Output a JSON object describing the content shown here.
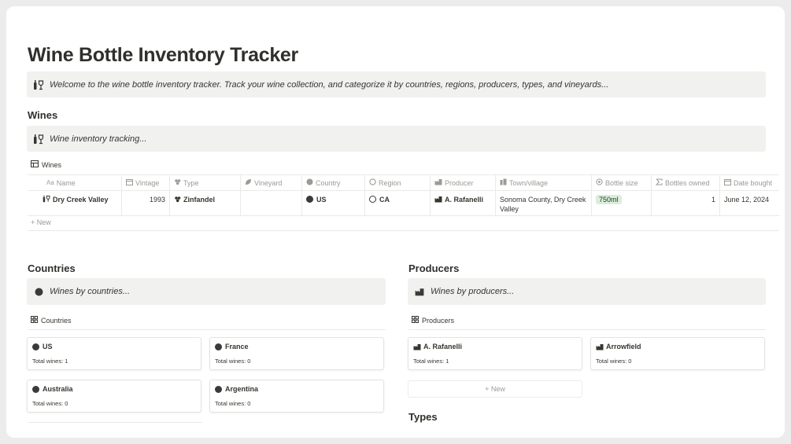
{
  "page": {
    "title": "Wine Bottle Inventory Tracker"
  },
  "intro": {
    "icon": "wine-glass-bottle-icon",
    "text": "Welcome to the wine bottle inventory tracker. Track your wine collection, and categorize it by countries, regions, producers, types, and vineyards..."
  },
  "wines": {
    "heading": "Wines",
    "callout_text": "Wine inventory tracking...",
    "view_label": "Wines",
    "columns": [
      {
        "label": "Name",
        "icon": "Aa"
      },
      {
        "label": "Vintage",
        "icon": "calendar-icon"
      },
      {
        "label": "Type",
        "icon": "grapes-icon"
      },
      {
        "label": "Vineyard",
        "icon": "leaf-icon"
      },
      {
        "label": "Country",
        "icon": "circle-icon"
      },
      {
        "label": "Region",
        "icon": "ring-icon"
      },
      {
        "label": "Producer",
        "icon": "factory-icon"
      },
      {
        "label": "Town/village",
        "icon": "building-icon"
      },
      {
        "label": "Bottle size",
        "icon": "target-icon"
      },
      {
        "label": "Bottles owned",
        "icon": "sigma-icon"
      },
      {
        "label": "Date bought",
        "icon": "calendar-icon"
      }
    ],
    "rows": [
      {
        "name": "Dry Creek Valley",
        "vintage": "1993",
        "type": "Zinfandel",
        "vineyard": "",
        "country": "US",
        "region": "CA",
        "producer": "A. Rafanelli",
        "town": "Sonoma County, Dry Creek Valley",
        "bottle_size": "750ml",
        "bottles_owned": "1",
        "date_bought": "June 12, 2024"
      }
    ],
    "new_label": "New"
  },
  "countries": {
    "heading": "Countries",
    "callout_text": "Wines by countries...",
    "view_label": "Countries",
    "cards": [
      {
        "name": "US",
        "total": "Total wines: 1"
      },
      {
        "name": "France",
        "total": "Total wines: 0"
      },
      {
        "name": "Australia",
        "total": "Total wines: 0"
      },
      {
        "name": "Argentina",
        "total": "Total wines: 0"
      }
    ]
  },
  "producers": {
    "heading": "Producers",
    "callout_text": "Wines by producers...",
    "view_label": "Producers",
    "cards": [
      {
        "name": "A. Rafanelli",
        "total": "Total wines: 1"
      },
      {
        "name": "Arrowfield",
        "total": "Total wines: 0"
      }
    ],
    "new_label": "New"
  },
  "types": {
    "heading": "Types"
  },
  "colors": {
    "bottle_tag_bg": "#dbeddb",
    "callout_bg": "#f1f1ef"
  }
}
